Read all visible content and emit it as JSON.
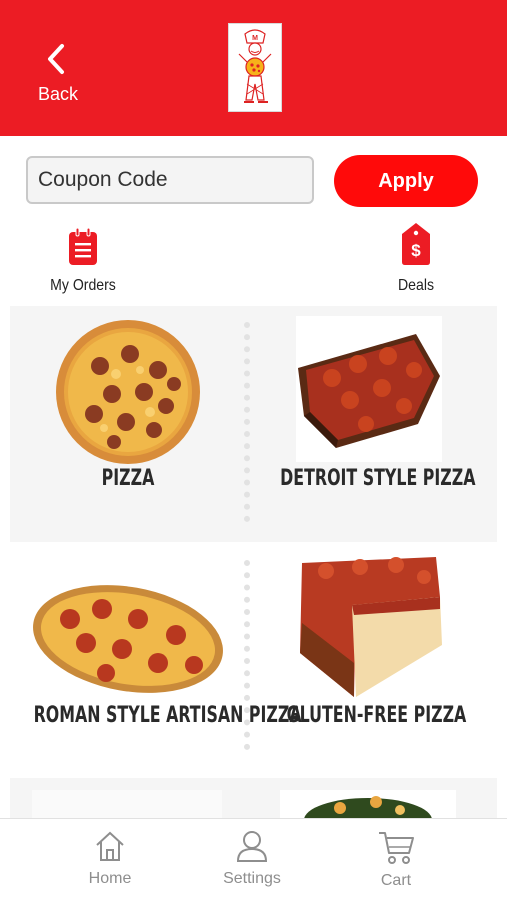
{
  "header": {
    "back_label": "Back",
    "logo_letter": "M"
  },
  "coupon": {
    "placeholder": "Coupon Code",
    "apply_label": "Apply"
  },
  "quick_links": {
    "orders_label": "My Orders",
    "deals_label": "Deals"
  },
  "categories": [
    {
      "label": "PIZZA"
    },
    {
      "label": "DETROIT STYLE PIZZA"
    },
    {
      "label": "ROMAN STYLE ARTISAN PIZZA"
    },
    {
      "label": "GLUTEN-FREE PIZZA"
    }
  ],
  "tabbar": {
    "home_label": "Home",
    "settings_label": "Settings",
    "cart_label": "Cart"
  },
  "colors": {
    "brand_red": "#ec1c24",
    "apply_red": "#ff0a0a",
    "tab_gray": "#8e8e8e"
  }
}
